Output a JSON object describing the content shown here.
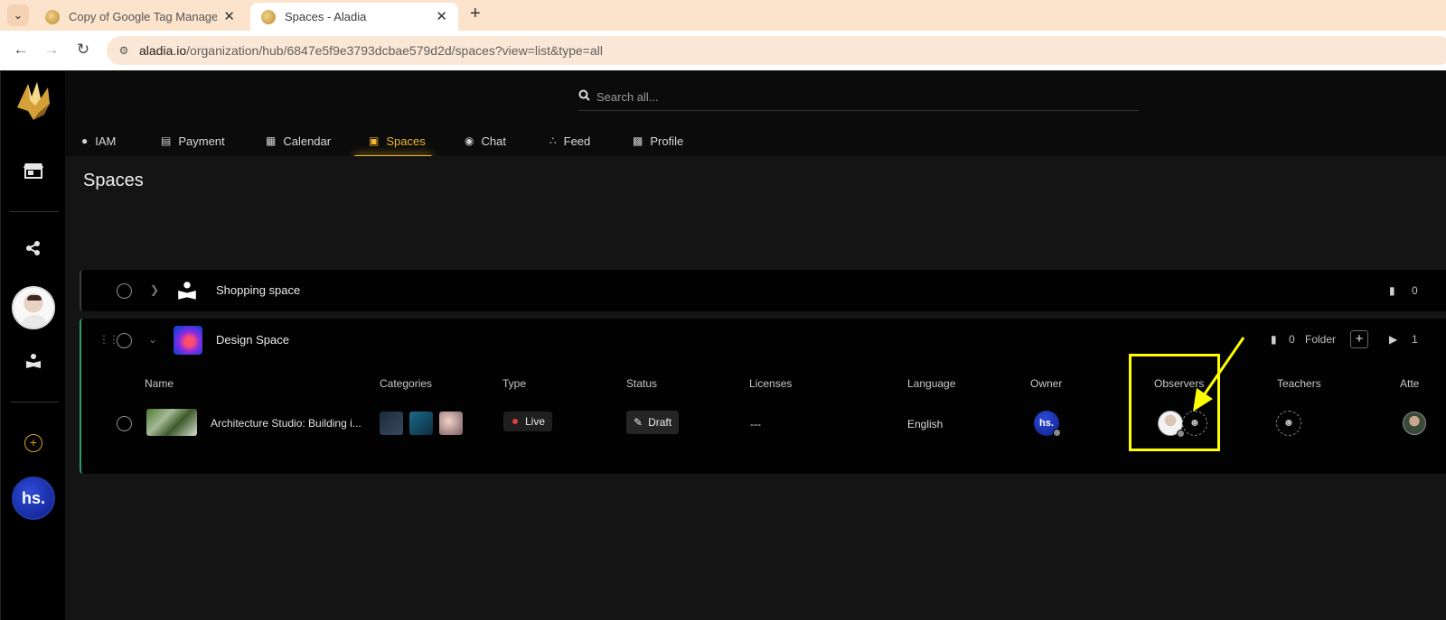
{
  "browser": {
    "tabs": [
      {
        "title": "Copy of Google Tag Manager",
        "active": false
      },
      {
        "title": "Spaces - Aladia",
        "active": true
      }
    ],
    "url_domain": "aladia.io",
    "url_path": "/organization/hub/6847e5f9e3793dcbae579d2d/spaces?view=list&type=all",
    "new_tab_label": "+"
  },
  "search": {
    "placeholder": "Search all..."
  },
  "nav": {
    "tabs": [
      {
        "label": "IAM",
        "icon": "user-icon"
      },
      {
        "label": "Payment",
        "icon": "credit-card-icon"
      },
      {
        "label": "Calendar",
        "icon": "calendar-icon"
      },
      {
        "label": "Spaces",
        "icon": "spaces-icon",
        "active": true
      },
      {
        "label": "Chat",
        "icon": "chat-icon"
      },
      {
        "label": "Feed",
        "icon": "share-icon"
      },
      {
        "label": "Profile",
        "icon": "id-card-icon"
      }
    ]
  },
  "sidebar": {
    "items": [
      "store-icon",
      "share-icon",
      "user-avatar",
      "book-reader-icon",
      "add-circle-icon",
      "org-avatar"
    ],
    "org_avatar_text": "hs."
  },
  "page": {
    "title": "Spaces"
  },
  "spaces": [
    {
      "name": "Shopping space",
      "folder_count": "0"
    },
    {
      "name": "Design Space",
      "folder_count": "0",
      "folder_label": "Folder",
      "video_count": "1",
      "columns": [
        "Name",
        "Categories",
        "Type",
        "Status",
        "Licenses",
        "Language",
        "Owner",
        "Observers",
        "Teachers",
        "Atte"
      ],
      "rows": [
        {
          "name": "Architecture Studio: Building i...",
          "type": "Live",
          "status": "Draft",
          "licenses": "---",
          "language": "English",
          "owner": "hs."
        }
      ]
    }
  ],
  "colors": {
    "accent": "#f5b82e",
    "live_dot": "#e23b3b",
    "annotation": "#ffff00",
    "design_border": "#2f9d6b"
  }
}
